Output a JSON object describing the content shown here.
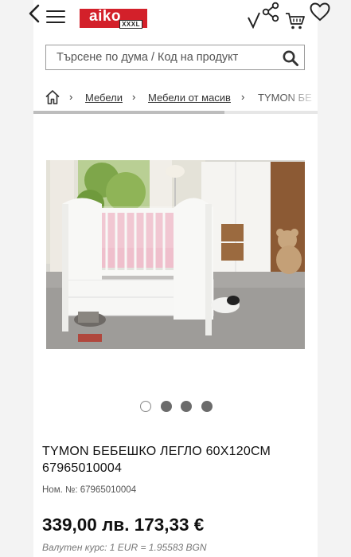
{
  "header": {
    "logo_text": "aiko",
    "logo_badge": "XXXL",
    "brand_color": "#d3202a",
    "icons": [
      "back-arrow-icon",
      "menu-icon",
      "compare-icon",
      "share-icon",
      "cart-icon",
      "heart-icon"
    ]
  },
  "search": {
    "placeholder": "Търсене по дума / Код на продукт",
    "value": ""
  },
  "breadcrumb": {
    "items": [
      "Мебели",
      "Мебели от масив",
      "TYMON БЕ"
    ]
  },
  "gallery": {
    "slide_count": 4,
    "active_index": 0
  },
  "product": {
    "title": "TYMON БЕБЕШКО ЛЕГЛО 60Х120СМ 67965010004",
    "number_label": "Ном. №:",
    "number_value": "67965010004",
    "price": "339,00 лв. 173,33 €",
    "exchange_rate": "Валутен курс: 1 EUR = 1.95583 BGN"
  }
}
